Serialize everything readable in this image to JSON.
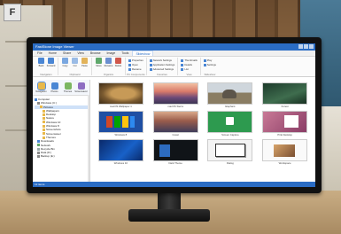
{
  "app": {
    "title": "FastStone Image Viewer",
    "window_buttons": [
      "minimize",
      "maximize",
      "close"
    ]
  },
  "menu": {
    "items": [
      "File",
      "Home",
      "Share",
      "View",
      "Browse",
      "Image",
      "Tools",
      "Slideshow"
    ],
    "active": "Slideshow"
  },
  "ribbon": {
    "groups": [
      {
        "label": "Navigation",
        "buttons": [
          "Back",
          "Forward"
        ]
      },
      {
        "label": "Clipboard",
        "buttons": [
          "Copy",
          "Cut",
          "Paste"
        ]
      },
      {
        "label": "Organize",
        "buttons": [
          "Move",
          "Rename",
          "Delete"
        ]
      },
      {
        "label": "PC Components",
        "list": [
          "Properties",
          "Open",
          "Rename",
          "Settings"
        ]
      },
      {
        "label": "Favorites",
        "list": [
          "Network Settings",
          "Application Settings",
          "Advanced Settings"
        ]
      },
      {
        "label": "View",
        "list": [
          "Thumbnails",
          "Details",
          "List"
        ]
      },
      {
        "label": "Slideshow",
        "list": [
          "Play",
          "Settings"
        ]
      }
    ]
  },
  "sidebar": {
    "nav_buttons": [
      "Navigation",
      "Photos",
      "Themes",
      "Screensaver"
    ],
    "tree": [
      "Computer",
      "Windows (C:)",
      "Pictures",
      "Wallpapers",
      "Desktop",
      "Nature",
      "Windows 10",
      "Windows 8",
      "Screenshots",
      "Screensaver",
      "Themes",
      "Downloads",
      "Network",
      "Recycle Bin",
      "Data (D:)",
      "Backup (E:)"
    ],
    "selected_index": 2
  },
  "thumbnails": [
    {
      "caption": "macOS Wallpaper 1",
      "icon": "lion-photo"
    },
    {
      "caption": "macOS Sierra",
      "icon": "mountain-photo"
    },
    {
      "caption": "Elephant",
      "icon": "elephant-photo"
    },
    {
      "caption": "Forest",
      "icon": "forest-photo"
    },
    {
      "caption": "Windows 8",
      "icon": "windows8-photo"
    },
    {
      "caption": "Coast",
      "icon": "coast-photo"
    },
    {
      "caption": "Screen Capture",
      "icon": "green-screen-photo"
    },
    {
      "caption": "Pink Desktop",
      "icon": "pink-photo"
    },
    {
      "caption": "Windows 10",
      "icon": "windows10-photo"
    },
    {
      "caption": "Dark Theme",
      "icon": "dark-screen-photo"
    },
    {
      "caption": "Dialog",
      "icon": "dialog-photo"
    },
    {
      "caption": "Workspace",
      "icon": "workspace-photo"
    }
  ],
  "status": {
    "text": "12 items"
  },
  "colors": {
    "accent": "#2a6cc4",
    "selection": "#cfe1f8",
    "monitor_bezel": "#111111"
  }
}
